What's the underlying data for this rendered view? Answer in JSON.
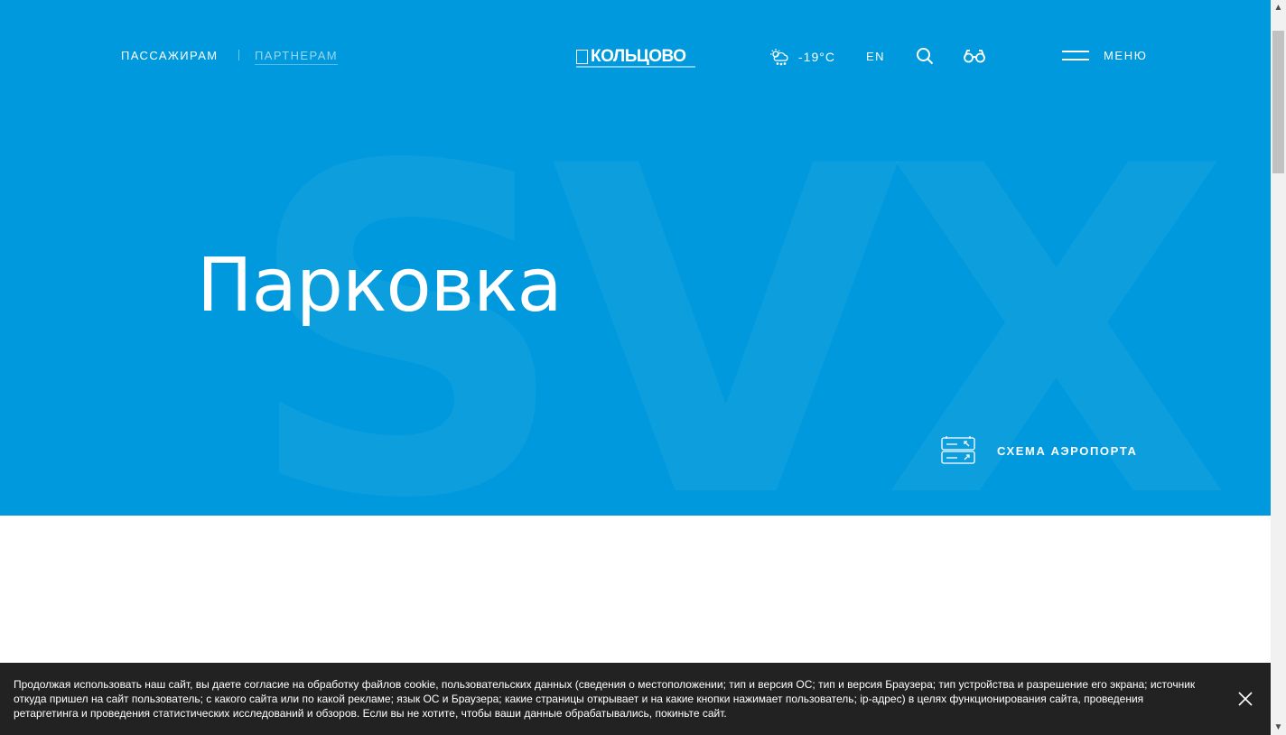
{
  "header": {
    "nav": [
      {
        "label": "ПАССАЖИРАМ"
      },
      {
        "label": "ПАРТНЕРАМ"
      }
    ],
    "logo_text": "КОЛЬЦОВО",
    "weather": {
      "icon": "cloud-snow-sun-icon",
      "temperature": "-19°C"
    },
    "language": "EN",
    "search_icon": "search-icon",
    "accessibility_icon": "glasses-icon",
    "menu_label": "МЕНЮ"
  },
  "hero": {
    "background_text": "SVX",
    "title": "Парковка",
    "background_color": "#0099dd",
    "scheme_label": "СХЕМА АЭРОПОРТА",
    "scheme_icon": "airport-map-icon"
  },
  "cookie_banner": {
    "text": "Продолжая использовать наш сайт, вы даете согласие на обработку файлов cookie, пользовательских данных (сведения о местоположении; тип и версия ОС; тип и версия Браузера; тип устройства и разрешение его экрана; источник откуда пришел на сайт пользователь; с какого сайта или по какой рекламе; язык ОС и Браузера; какие страницы открывает и на какие кнопки нажимает пользователь; ip-адрес) в целях функционирования сайта, проведения ретаргетинга и проведения статистических исследований и обзоров. Если вы не хотите, чтобы ваши данные обрабатывались, покиньте сайт.",
    "close_icon": "close-icon",
    "background_color": "#222222"
  }
}
